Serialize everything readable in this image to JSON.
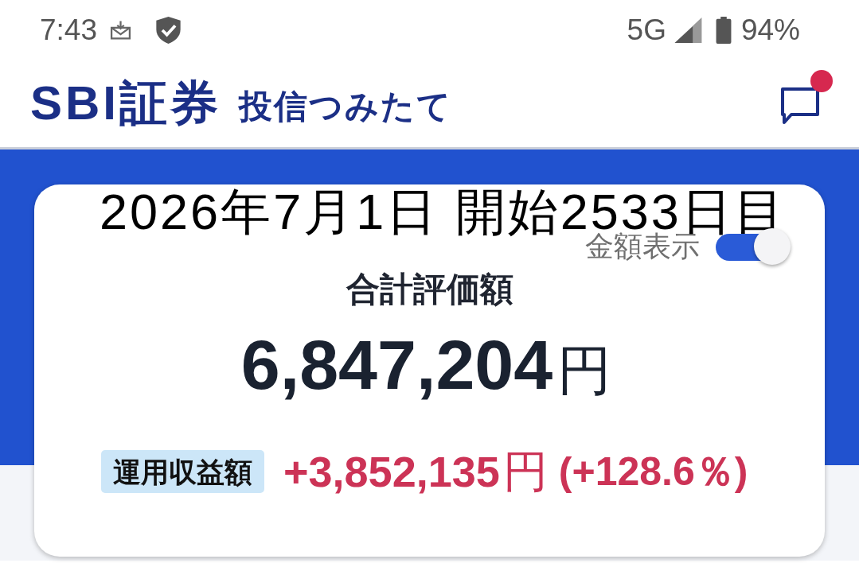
{
  "status_bar": {
    "time": "7:43",
    "network": "5G",
    "battery": "94%"
  },
  "header": {
    "logo": "SBI証券",
    "title": "投信つみたて",
    "unread": true
  },
  "caption": "2026年7月1日 開始2533日目",
  "summary_card": {
    "amount_toggle": {
      "label": "金額表示",
      "on": true
    },
    "total_label": "合計評価額",
    "total_value": "6,847,204",
    "total_unit": "円",
    "profit_label": "運用収益額",
    "profit_value": "+3,852,135",
    "profit_unit": "円",
    "profit_rate": "(+128.6％)"
  }
}
